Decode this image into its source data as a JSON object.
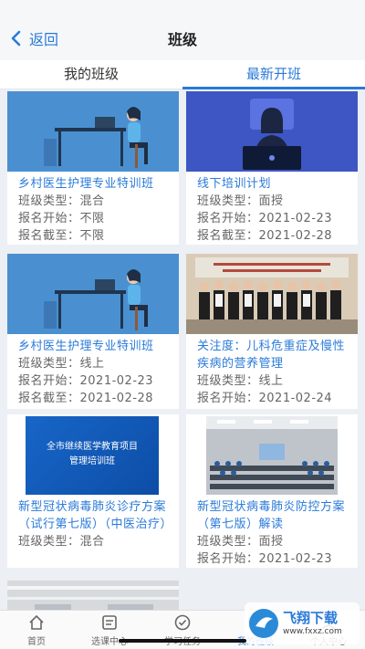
{
  "header": {
    "back_label": "返回",
    "title": "班级"
  },
  "tabs": [
    {
      "label": "我的班级"
    },
    {
      "label": "最新开班"
    }
  ],
  "cards": [
    {
      "title": "乡村医生护理专业特训班",
      "lines": [
        "班级类型：混合",
        "报名开始：不限",
        "报名截至：不限"
      ]
    },
    {
      "title": "线下培训计划",
      "lines": [
        "班级类型：面授",
        "报名开始：2021-02-23",
        "报名截至：2021-02-28"
      ]
    },
    {
      "title": "乡村医生护理专业特训班",
      "lines": [
        "班级类型：线上",
        "报名开始：2021-02-23",
        "报名截至：2021-02-28"
      ]
    },
    {
      "title": "关注度：儿科危重症及慢性疾病的营养管理",
      "lines": [
        "班级类型：线上",
        "报名开始：2021-02-24"
      ]
    },
    {
      "title": "新型冠状病毒肺炎诊疗方案（试行第七版）（中医治疗）",
      "lines": [
        "班级类型：混合"
      ]
    },
    {
      "title": "新型冠状病毒肺炎防控方案（第七版）解读",
      "lines": [
        "班级类型：面授",
        "报名开始：2021-02-23"
      ]
    }
  ],
  "banner": {
    "line1": "全市继续医学教育项目",
    "line2": "管理培训班"
  },
  "bottom_nav": [
    {
      "label": "首页"
    },
    {
      "label": "选课中心"
    },
    {
      "label": "学习任务"
    },
    {
      "label": "我的班级"
    },
    {
      "label": "个人中心"
    }
  ],
  "watermark": {
    "text": "飞翔下载",
    "url": "www.fxxz.com"
  },
  "colors": {
    "accent": "#2a7ad8",
    "background": "#eceff3"
  }
}
